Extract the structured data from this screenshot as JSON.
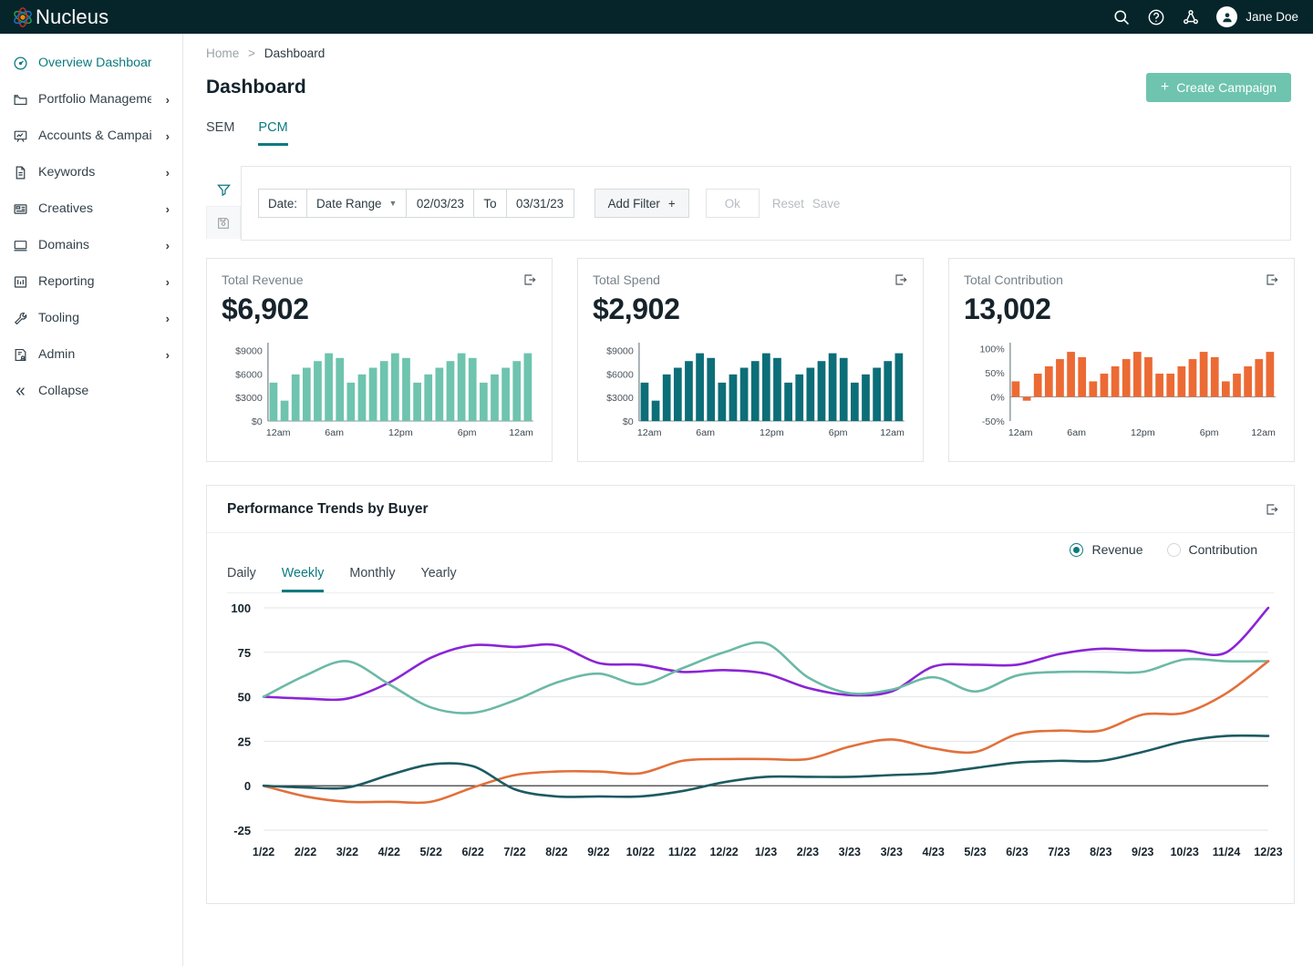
{
  "topbar": {
    "brand": "Nucleus",
    "logo_icon": "atom-icon",
    "icons": [
      {
        "name": "search-icon",
        "label": "Search"
      },
      {
        "name": "help-icon",
        "label": "Help"
      },
      {
        "name": "share-network-icon",
        "label": "Network"
      }
    ],
    "user": {
      "name": "Jane Doe",
      "avatar_icon": "user-avatar-icon"
    }
  },
  "sidebar": {
    "items": [
      {
        "label": "Overview Dashboard",
        "icon": "speedometer-icon",
        "active": true,
        "chevron": false
      },
      {
        "label": "Portfolio Management",
        "icon": "folder-icon",
        "active": false,
        "chevron": true
      },
      {
        "label": "Accounts & Campaigns",
        "icon": "presentation-chart-icon",
        "active": false,
        "chevron": true
      },
      {
        "label": "Keywords",
        "icon": "document-icon",
        "active": false,
        "chevron": true
      },
      {
        "label": "Creatives",
        "icon": "list-layout-icon",
        "active": false,
        "chevron": true
      },
      {
        "label": "Domains",
        "icon": "monitor-icon",
        "active": false,
        "chevron": true
      },
      {
        "label": "Reporting",
        "icon": "report-icon",
        "active": false,
        "chevron": true
      },
      {
        "label": "Tooling",
        "icon": "wrench-icon",
        "active": false,
        "chevron": true
      },
      {
        "label": "Admin",
        "icon": "admin-user-icon",
        "active": false,
        "chevron": true
      }
    ],
    "collapse": {
      "label": "Collapse",
      "icon": "double-chevron-left-icon"
    }
  },
  "breadcrumb": {
    "home": "Home",
    "separator": ">",
    "current": "Dashboard"
  },
  "header": {
    "title": "Dashboard",
    "create_button": "Create Campaign",
    "create_button_icon": "plus-icon",
    "create_button_color": "#6ec4ae"
  },
  "tabs": [
    {
      "label": "SEM",
      "active": false
    },
    {
      "label": "PCM",
      "active": true
    }
  ],
  "filter": {
    "filter_icon": "funnel-icon",
    "save_icon": "floppy-disk-icon",
    "date_label": "Date:",
    "range_type": "Date Range",
    "range_caret": "chevron-down-icon",
    "date_from": "02/03/23",
    "to_label": "To",
    "date_to": "03/31/23",
    "add_filter": "Add Filter",
    "add_filter_icon": "plus-icon",
    "ok": "Ok",
    "reset": "Reset",
    "save": "Save"
  },
  "cards": [
    {
      "title": "Total Revenue",
      "value": "$6,902",
      "export_icon": "export-icon",
      "color": "#6ec4ae"
    },
    {
      "title": "Total Spend",
      "value": "$2,902",
      "export_icon": "export-icon",
      "color": "#0c6e78"
    },
    {
      "title": "Total Contribution",
      "value": "13,002",
      "export_icon": "export-icon",
      "color": "#ec6a34"
    }
  ],
  "trends": {
    "title": "Performance Trends by Buyer",
    "export_icon": "export-icon",
    "radio_options": [
      {
        "label": "Revenue",
        "selected": true
      },
      {
        "label": "Contribution",
        "selected": false
      }
    ],
    "granularity_tabs": [
      {
        "label": "Daily",
        "active": false
      },
      {
        "label": "Weekly",
        "active": true
      },
      {
        "label": "Monthly",
        "active": false
      },
      {
        "label": "Yearly",
        "active": false
      }
    ]
  },
  "chart_data": [
    {
      "type": "bar",
      "title": "Total Revenue",
      "xlabel": "",
      "ylabel": "",
      "ylim": [
        0,
        10000
      ],
      "ytick_labels": [
        "$9000",
        "$6000",
        "$3000",
        "$0"
      ],
      "yticks": [
        9000,
        6000,
        3000,
        0
      ],
      "xtick_labels": [
        "12am",
        "6am",
        "12pm",
        "6pm",
        "12am"
      ],
      "categories": [
        "0",
        "1",
        "2",
        "3",
        "4",
        "5",
        "6",
        "7",
        "8",
        "9",
        "10",
        "11",
        "12",
        "13",
        "14",
        "15",
        "16",
        "17",
        "18",
        "19",
        "20",
        "21",
        "22",
        "23"
      ],
      "values": [
        4900,
        2600,
        5950,
        6800,
        7650,
        8650,
        8050,
        4900,
        5950,
        6800,
        7650,
        8650,
        8050,
        4900,
        5950,
        6800,
        7650,
        8650,
        8050,
        4900,
        5950,
        6800,
        7650,
        8650
      ],
      "grid": false,
      "legend": "none"
    },
    {
      "type": "bar",
      "title": "Total Spend",
      "xlabel": "",
      "ylabel": "",
      "ylim": [
        0,
        10000
      ],
      "ytick_labels": [
        "$9000",
        "$6000",
        "$3000",
        "$0"
      ],
      "yticks": [
        9000,
        6000,
        3000,
        0
      ],
      "xtick_labels": [
        "12am",
        "6am",
        "12pm",
        "6pm",
        "12am"
      ],
      "categories": [
        "0",
        "1",
        "2",
        "3",
        "4",
        "5",
        "6",
        "7",
        "8",
        "9",
        "10",
        "11",
        "12",
        "13",
        "14",
        "15",
        "16",
        "17",
        "18",
        "19",
        "20",
        "21",
        "22",
        "23"
      ],
      "values": [
        4900,
        2600,
        5950,
        6800,
        7650,
        8650,
        8050,
        4900,
        5950,
        6800,
        7650,
        8650,
        8050,
        4900,
        5950,
        6800,
        7650,
        8650,
        8050,
        4900,
        5950,
        6800,
        7650,
        8650
      ],
      "grid": false,
      "legend": "none"
    },
    {
      "type": "bar",
      "title": "Total Contribution",
      "xlabel": "",
      "ylabel": "",
      "ylim": [
        -50,
        112
      ],
      "ytick_labels": [
        "100%",
        "50%",
        "0%",
        "-50%"
      ],
      "yticks": [
        100,
        50,
        0,
        -50
      ],
      "xtick_labels": [
        "12am",
        "6am",
        "12pm",
        "6pm",
        "12am"
      ],
      "categories": [
        "0",
        "1",
        "2",
        "3",
        "4",
        "5",
        "6",
        "7",
        "8",
        "9",
        "10",
        "11",
        "12",
        "13",
        "14",
        "15",
        "16",
        "17",
        "18",
        "19",
        "20",
        "21",
        "22",
        "23"
      ],
      "values": [
        32,
        -8,
        48,
        63,
        78,
        93,
        82,
        32,
        48,
        63,
        78,
        93,
        82,
        48,
        48,
        63,
        78,
        93,
        82,
        32,
        48,
        63,
        78,
        93
      ],
      "grid": false,
      "legend": "none"
    },
    {
      "type": "line",
      "title": "Performance Trends by Buyer",
      "xlabel": "",
      "ylabel": "",
      "ylim": [
        -25,
        100
      ],
      "yticks": [
        100,
        75,
        50,
        25,
        0,
        -25
      ],
      "ytick_labels": [
        "100",
        "75",
        "50",
        "25",
        "0",
        "-25"
      ],
      "x": [
        "1/22",
        "2/22",
        "3/22",
        "4/22",
        "5/22",
        "6/22",
        "7/22",
        "8/22",
        "9/22",
        "10/22",
        "11/22",
        "12/22",
        "1/23",
        "2/23",
        "3/23",
        "3/23",
        "4/23",
        "5/23",
        "6/23",
        "7/23",
        "8/23",
        "9/23",
        "10/23",
        "11/24",
        "12/23"
      ],
      "grid": true,
      "legend": "none",
      "series": [
        {
          "name": "buyer-purple",
          "color": "#8b24d6",
          "values": [
            50,
            49,
            49,
            58,
            72,
            79,
            78,
            79,
            69,
            68,
            64,
            65,
            63,
            55,
            51,
            53,
            67,
            68,
            68,
            74,
            77,
            76,
            76,
            75,
            100
          ]
        },
        {
          "name": "buyer-green",
          "color": "#6bb9a6",
          "values": [
            50,
            62,
            70,
            57,
            44,
            41,
            48,
            58,
            63,
            57,
            66,
            75,
            80,
            61,
            52,
            54,
            61,
            53,
            62,
            64,
            64,
            64,
            71,
            70,
            70
          ]
        },
        {
          "name": "buyer-orange",
          "color": "#e2703a",
          "values": [
            0,
            -6,
            -9,
            -9,
            -9,
            -1,
            6,
            8,
            8,
            7,
            14,
            15,
            15,
            15,
            22,
            26,
            21,
            19,
            29,
            31,
            31,
            40,
            41,
            52,
            70
          ]
        },
        {
          "name": "buyer-teal",
          "color": "#1d5b62",
          "values": [
            0,
            -1,
            -1,
            6,
            12,
            11,
            -2,
            -6,
            -6,
            -6,
            -3,
            2,
            5,
            5,
            5,
            6,
            7,
            10,
            13,
            14,
            14,
            19,
            25,
            28,
            28
          ]
        }
      ]
    }
  ]
}
